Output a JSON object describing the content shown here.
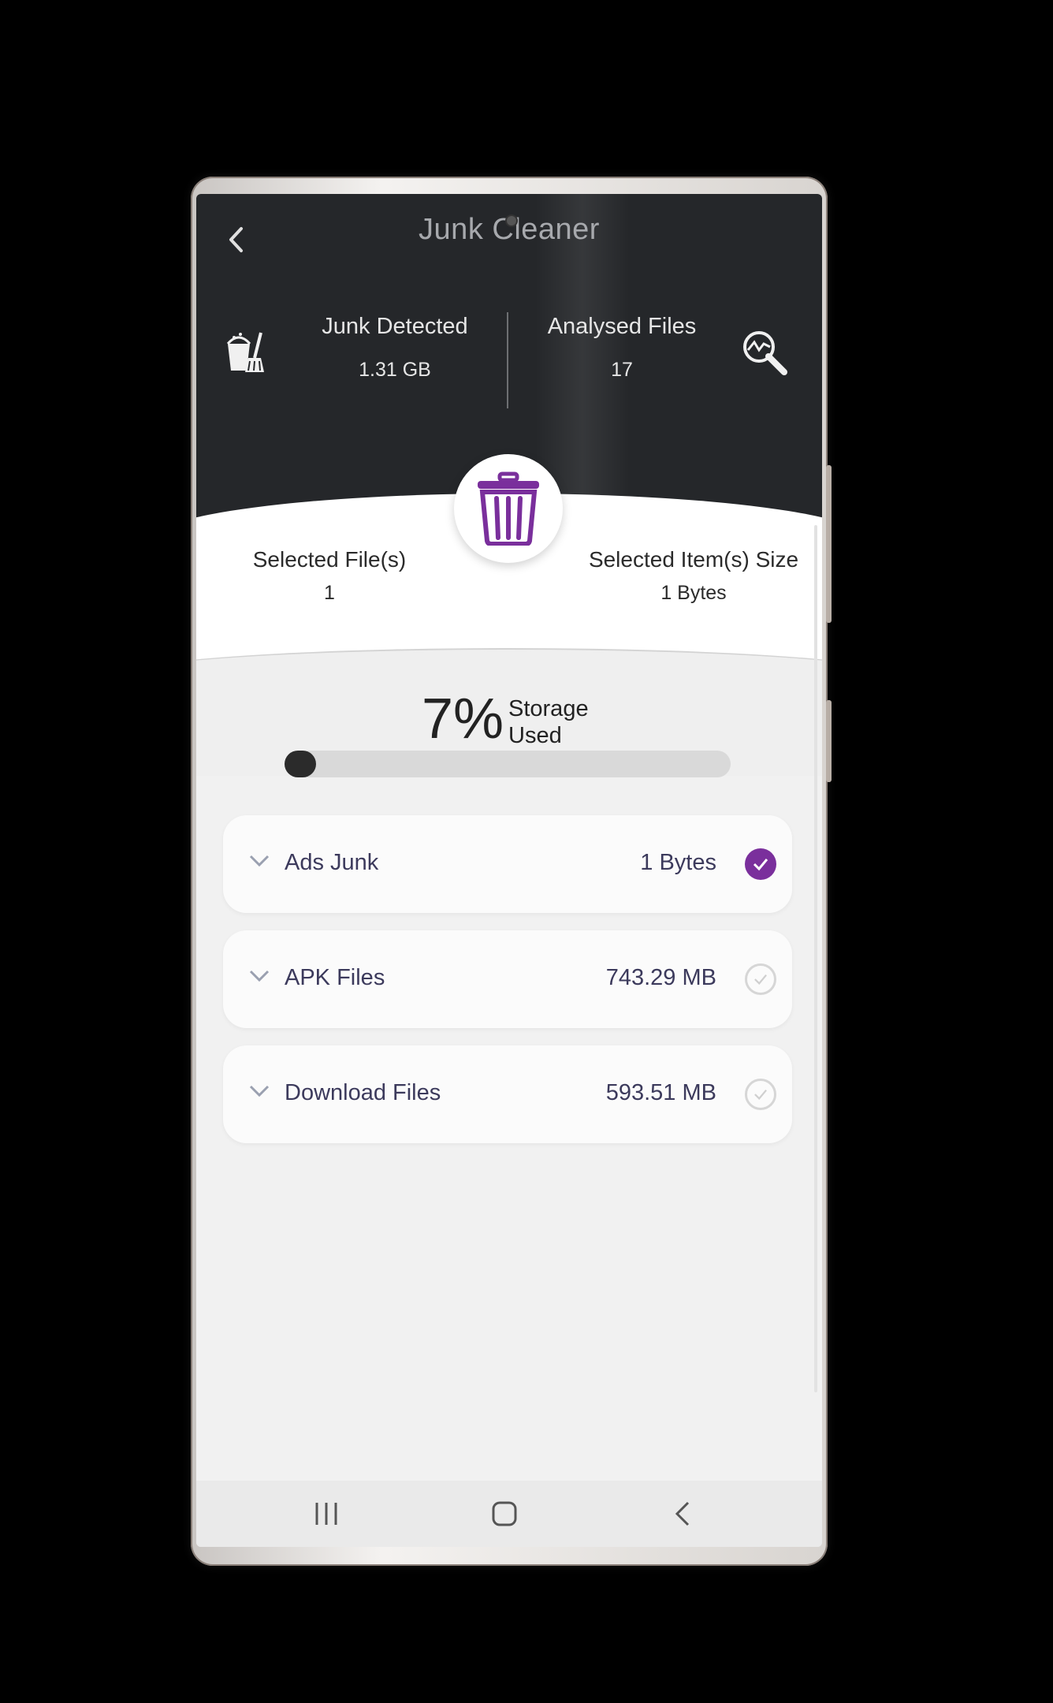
{
  "header": {
    "title": "Junk Cleaner",
    "back_icon": "chevron-left-icon",
    "junk_detected": {
      "label": "Junk Detected",
      "value": "1.31 GB",
      "icon": "cleaning-bucket-icon"
    },
    "analysed_files": {
      "label": "Analysed Files",
      "value": "17",
      "icon": "search-analysis-icon"
    }
  },
  "selection": {
    "files": {
      "label": "Selected File(s)",
      "value": "1"
    },
    "size": {
      "label": "Selected Item(s) Size",
      "value": "1 Bytes"
    },
    "delete_icon": "trash-icon"
  },
  "storage": {
    "percent_text": "7%",
    "label_line1": "Storage",
    "label_line2": "Used",
    "percent_value": 7
  },
  "categories": [
    {
      "name": "Ads Junk",
      "size": "1 Bytes",
      "checked": true
    },
    {
      "name": "APK Files",
      "size": "743.29 MB",
      "checked": false
    },
    {
      "name": "Download Files",
      "size": "593.51 MB",
      "checked": false
    }
  ],
  "navbar": {
    "recents_icon": "recents-icon",
    "home_icon": "home-icon",
    "back_icon": "back-icon"
  },
  "colors": {
    "header_bg": "#25272a",
    "accent": "#7a2f9c",
    "text_dark": "#3c3a5c"
  }
}
